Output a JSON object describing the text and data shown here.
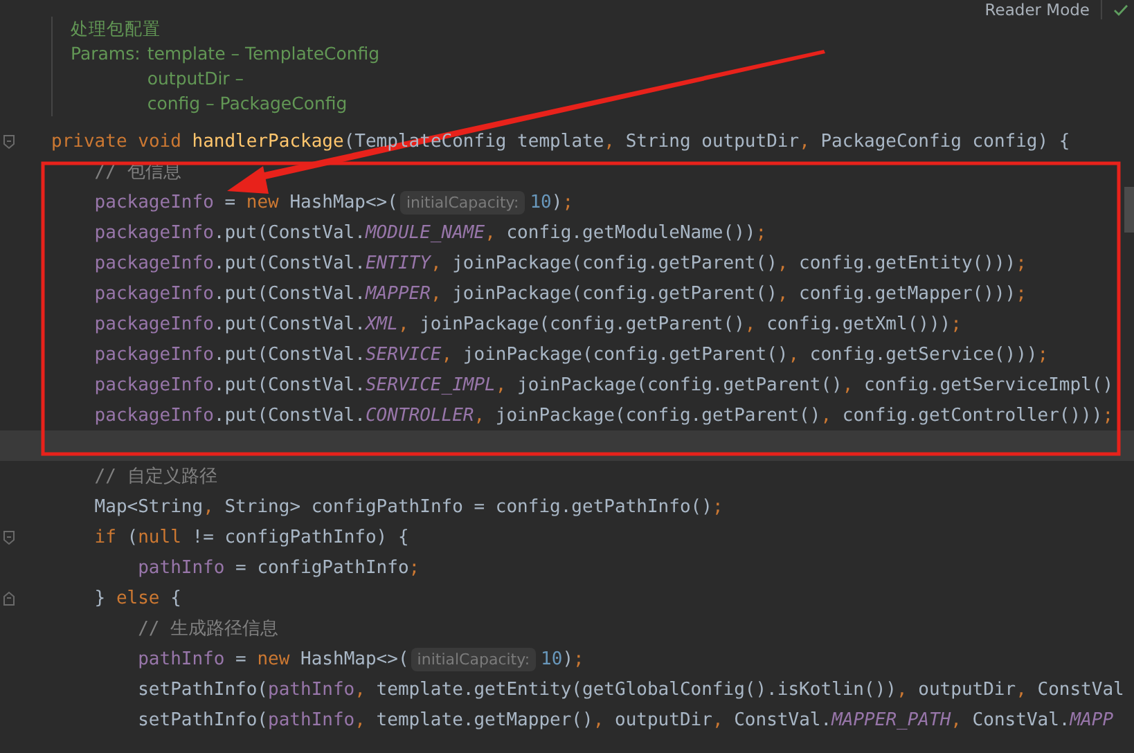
{
  "toolbar": {
    "reader_mode": "Reader Mode"
  },
  "doc_comment": {
    "title": "处理包配置",
    "params_label": "Params:",
    "params": [
      "template – TemplateConfig",
      "outputDir –",
      "config – PackageConfig"
    ]
  },
  "code": [
    {
      "tokens": [
        {
          "kind": "kw",
          "text": "private void "
        },
        {
          "kind": "decl",
          "text": "handlerPackage"
        },
        {
          "kind": "plain",
          "text": "(TemplateConfig template"
        },
        {
          "kind": "punct",
          "text": ","
        },
        {
          "kind": "plain",
          "text": " String outputDir"
        },
        {
          "kind": "punct",
          "text": ","
        },
        {
          "kind": "plain",
          "text": " PackageConfig config) {"
        }
      ],
      "children": [
        {
          "tokens": [
            {
              "kind": "comment",
              "text": "// 包信息"
            }
          ]
        },
        {
          "tokens": [
            {
              "kind": "field",
              "text": "packageInfo"
            },
            {
              "kind": "plain",
              "text": " = "
            },
            {
              "kind": "kw",
              "text": "new "
            },
            {
              "kind": "plain",
              "text": "HashMap<>("
            },
            {
              "kind": "hint",
              "text": "initialCapacity:"
            },
            {
              "kind": "num",
              "text": "10"
            },
            {
              "kind": "plain",
              "text": ")"
            },
            {
              "kind": "punct",
              "text": ";"
            }
          ]
        },
        {
          "tokens": [
            {
              "kind": "field",
              "text": "packageInfo"
            },
            {
              "kind": "plain",
              "text": ".put(ConstVal."
            },
            {
              "kind": "const",
              "text": "MODULE_NAME"
            },
            {
              "kind": "punct",
              "text": ","
            },
            {
              "kind": "plain",
              "text": " config.getModuleName())"
            },
            {
              "kind": "punct",
              "text": ";"
            }
          ]
        },
        {
          "tokens": [
            {
              "kind": "field",
              "text": "packageInfo"
            },
            {
              "kind": "plain",
              "text": ".put(ConstVal."
            },
            {
              "kind": "const",
              "text": "ENTITY"
            },
            {
              "kind": "punct",
              "text": ","
            },
            {
              "kind": "plain",
              "text": " joinPackage(config.getParent()"
            },
            {
              "kind": "punct",
              "text": ","
            },
            {
              "kind": "plain",
              "text": " config.getEntity()))"
            },
            {
              "kind": "punct",
              "text": ";"
            }
          ]
        },
        {
          "tokens": [
            {
              "kind": "field",
              "text": "packageInfo"
            },
            {
              "kind": "plain",
              "text": ".put(ConstVal."
            },
            {
              "kind": "const",
              "text": "MAPPER"
            },
            {
              "kind": "punct",
              "text": ","
            },
            {
              "kind": "plain",
              "text": " joinPackage(config.getParent()"
            },
            {
              "kind": "punct",
              "text": ","
            },
            {
              "kind": "plain",
              "text": " config.getMapper()))"
            },
            {
              "kind": "punct",
              "text": ";"
            }
          ]
        },
        {
          "tokens": [
            {
              "kind": "field",
              "text": "packageInfo"
            },
            {
              "kind": "plain",
              "text": ".put(ConstVal."
            },
            {
              "kind": "const",
              "text": "XML"
            },
            {
              "kind": "punct",
              "text": ","
            },
            {
              "kind": "plain",
              "text": " joinPackage(config.getParent()"
            },
            {
              "kind": "punct",
              "text": ","
            },
            {
              "kind": "plain",
              "text": " config.getXml()))"
            },
            {
              "kind": "punct",
              "text": ";"
            }
          ]
        },
        {
          "tokens": [
            {
              "kind": "field",
              "text": "packageInfo"
            },
            {
              "kind": "plain",
              "text": ".put(ConstVal."
            },
            {
              "kind": "const",
              "text": "SERVICE"
            },
            {
              "kind": "punct",
              "text": ","
            },
            {
              "kind": "plain",
              "text": " joinPackage(config.getParent()"
            },
            {
              "kind": "punct",
              "text": ","
            },
            {
              "kind": "plain",
              "text": " config.getService()))"
            },
            {
              "kind": "punct",
              "text": ";"
            }
          ]
        },
        {
          "tokens": [
            {
              "kind": "field",
              "text": "packageInfo"
            },
            {
              "kind": "plain",
              "text": ".put(ConstVal."
            },
            {
              "kind": "const",
              "text": "SERVICE_IMPL"
            },
            {
              "kind": "punct",
              "text": ","
            },
            {
              "kind": "plain",
              "text": " joinPackage(config.getParent()"
            },
            {
              "kind": "punct",
              "text": ","
            },
            {
              "kind": "plain",
              "text": " config.getServiceImpl()"
            }
          ]
        },
        {
          "tokens": [
            {
              "kind": "field",
              "text": "packageInfo"
            },
            {
              "kind": "plain",
              "text": ".put(ConstVal."
            },
            {
              "kind": "const",
              "text": "CONTROLLER"
            },
            {
              "kind": "punct",
              "text": ","
            },
            {
              "kind": "plain",
              "text": " joinPackage(config.getParent()"
            },
            {
              "kind": "punct",
              "text": ","
            },
            {
              "kind": "plain",
              "text": " config.getController()))"
            },
            {
              "kind": "punct",
              "text": ";"
            }
          ]
        },
        {
          "current": true
        },
        {
          "tokens": [
            {
              "kind": "comment",
              "text": "// 自定义路径"
            }
          ]
        },
        {
          "tokens": [
            {
              "kind": "plain",
              "text": "Map<String"
            },
            {
              "kind": "punct",
              "text": ","
            },
            {
              "kind": "plain",
              "text": " String> configPathInfo = config.getPathInfo()"
            },
            {
              "kind": "punct",
              "text": ";"
            }
          ]
        },
        {
          "tokens": [
            {
              "kind": "kw",
              "text": "if "
            },
            {
              "kind": "plain",
              "text": "("
            },
            {
              "kind": "kw",
              "text": "null "
            },
            {
              "kind": "plain",
              "text": "!= configPathInfo) {"
            }
          ],
          "children": [
            {
              "tokens": [
                {
                  "kind": "field",
                  "text": "pathInfo"
                },
                {
                  "kind": "plain",
                  "text": " = configPathInfo"
                },
                {
                  "kind": "punct",
                  "text": ";"
                }
              ]
            }
          ]
        },
        {
          "tokens": [
            {
              "kind": "plain",
              "text": "} "
            },
            {
              "kind": "kw",
              "text": "else "
            },
            {
              "kind": "plain",
              "text": "{"
            }
          ],
          "children": [
            {
              "tokens": [
                {
                  "kind": "comment",
                  "text": "// 生成路径信息"
                }
              ]
            },
            {
              "tokens": [
                {
                  "kind": "field",
                  "text": "pathInfo"
                },
                {
                  "kind": "plain",
                  "text": " = "
                },
                {
                  "kind": "kw",
                  "text": "new "
                },
                {
                  "kind": "plain",
                  "text": "HashMap<>("
                },
                {
                  "kind": "hint",
                  "text": "initialCapacity:"
                },
                {
                  "kind": "num",
                  "text": "10"
                },
                {
                  "kind": "plain",
                  "text": ")"
                },
                {
                  "kind": "punct",
                  "text": ";"
                }
              ]
            },
            {
              "tokens": [
                {
                  "kind": "plain",
                  "text": "setPathInfo("
                },
                {
                  "kind": "field",
                  "text": "pathInfo"
                },
                {
                  "kind": "punct",
                  "text": ","
                },
                {
                  "kind": "plain",
                  "text": " template.getEntity(getGlobalConfig().isKotlin())"
                },
                {
                  "kind": "punct",
                  "text": ","
                },
                {
                  "kind": "plain",
                  "text": " outputDir"
                },
                {
                  "kind": "punct",
                  "text": ","
                },
                {
                  "kind": "plain",
                  "text": " ConstVal"
                }
              ]
            },
            {
              "tokens": [
                {
                  "kind": "plain",
                  "text": "setPathInfo("
                },
                {
                  "kind": "field",
                  "text": "pathInfo"
                },
                {
                  "kind": "punct",
                  "text": ","
                },
                {
                  "kind": "plain",
                  "text": " template.getMapper()"
                },
                {
                  "kind": "punct",
                  "text": ","
                },
                {
                  "kind": "plain",
                  "text": " outputDir"
                },
                {
                  "kind": "punct",
                  "text": ","
                },
                {
                  "kind": "plain",
                  "text": " ConstVal."
                },
                {
                  "kind": "const",
                  "text": "MAPPER_PATH"
                },
                {
                  "kind": "punct",
                  "text": ","
                },
                {
                  "kind": "plain",
                  "text": " ConstVal."
                },
                {
                  "kind": "const",
                  "text": "MAPP"
                }
              ]
            }
          ]
        }
      ]
    }
  ]
}
